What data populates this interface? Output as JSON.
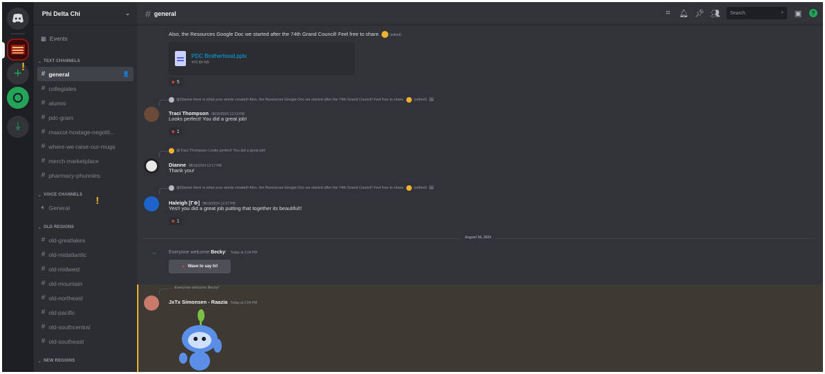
{
  "server": {
    "name": "Phi Delta Chi"
  },
  "sidebar": {
    "events_label": "Events",
    "categories": {
      "text": "TEXT CHANNELS",
      "voice": "VOICE CHANNELS",
      "old": "OLD REGIONS",
      "new": "NEW REGIONS"
    },
    "text_channels": [
      "general",
      "collegiates",
      "alumni",
      "pdc-gram",
      "mascot-hostage-negotit...",
      "where-we-raise-our-mugs",
      "merch-marketplace",
      "pharmacy-phunnies"
    ],
    "voice_channels": [
      "General"
    ],
    "old_regions": [
      "old-greatlakes",
      "old-midatlantic",
      "old-midwest",
      "old-mountain",
      "old-northeast",
      "old-pacific",
      "old-southcentral",
      "old-southeast"
    ]
  },
  "topbar": {
    "channel": "general",
    "search_placeholder": "Search"
  },
  "messages": {
    "first_text": "Also, the Resources Google Doc we started after the 74th Grand Council! Feel free to share.",
    "edited": "(edited)",
    "attachment": {
      "name": "PDC Brotherhood.pptx",
      "size": "470.80 KB"
    },
    "first_reaction": "5",
    "traci": {
      "reply": "@Dianne Here is what your words created! Also, the Resources Google Doc we started after the 74th Grand Council! Feel free to share.",
      "author": "Traci Thompson",
      "time": "08/16/2024 12:13 PM",
      "text": "Looks perfect! You did a great job!",
      "reaction": "1"
    },
    "dianne": {
      "reply": "@Traci Thompson Looks perfect! You did a great job!",
      "author": "Dianne",
      "time": "08/16/2024 12:17 PM",
      "text": "Thank you!"
    },
    "haleigh": {
      "reply": "@Dianne Here is what your words created! Also, the Resources Google Doc we started after the 74th Grand Council! Feel free to share.",
      "author": "Haleigh [Γ⊕]",
      "time": "08/16/2024 12:27 PM",
      "text": "Yes!! you did a great job putting that together its beautiful!!",
      "reaction": "1"
    },
    "date_divider": "August 26, 2024",
    "welcome": {
      "prefix": "Everyone welcome",
      "name": "Becky",
      "suffix": "!",
      "time": "Today at 2:04 PM",
      "button": "Wave to say hi!"
    },
    "jxtx": {
      "reply": "Everyone welcome Becky!",
      "author": "JxTx Simonsen - Raazia",
      "time": "Today at 2:04 PM"
    }
  },
  "colors": {
    "accent_green": "#23a559",
    "link": "#00a8fc",
    "highlight": "#f0b232",
    "heart": "#f23f42"
  }
}
